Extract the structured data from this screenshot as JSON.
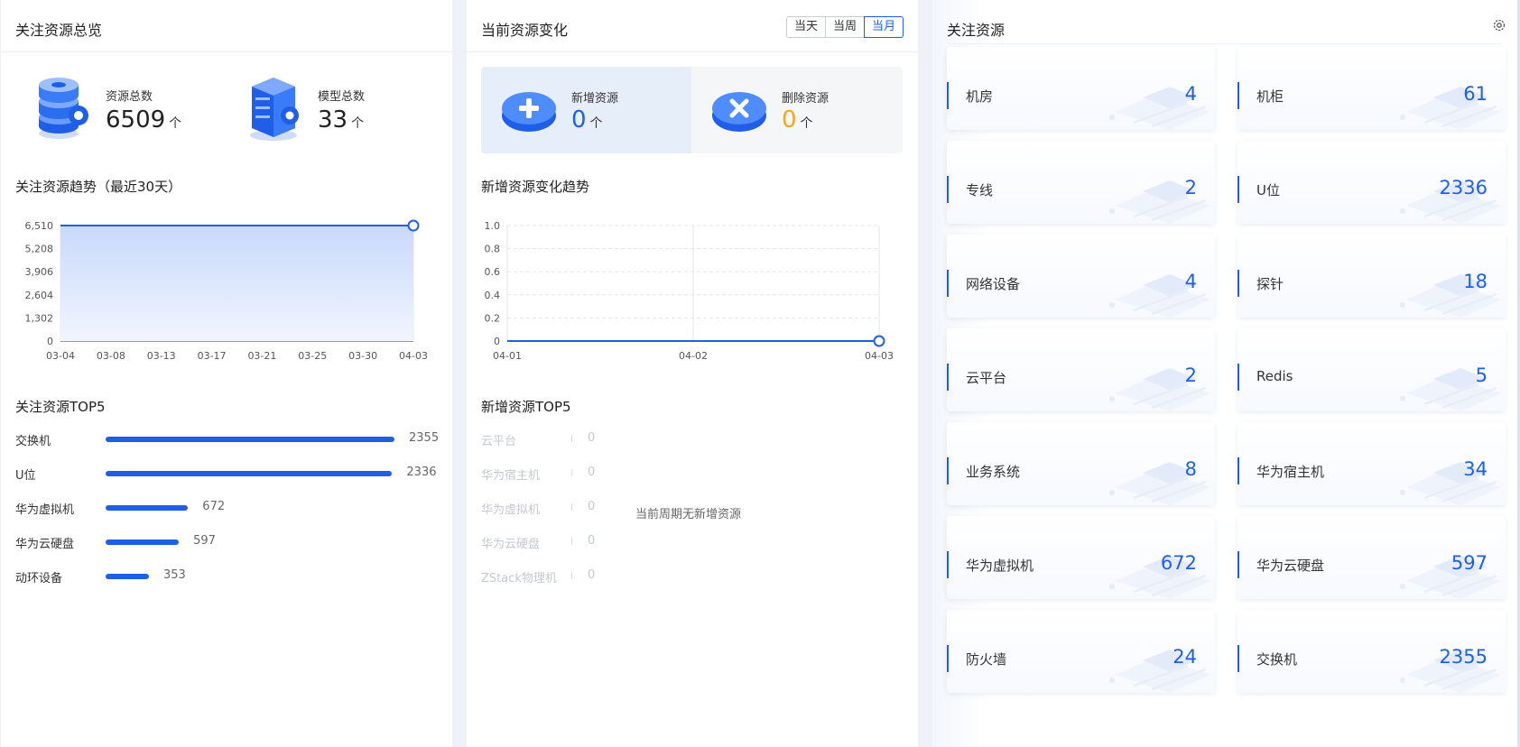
{
  "overview": {
    "title": "关注资源总览",
    "stats": [
      {
        "label": "资源总数",
        "value": "6509",
        "unit": "个"
      },
      {
        "label": "模型总数",
        "value": "33",
        "unit": "个"
      }
    ],
    "trend_title": "关注资源趋势（最近30天）",
    "top_title": "关注资源TOP5",
    "top_items": [
      {
        "name": "交换机",
        "value": 2355
      },
      {
        "name": "U位",
        "value": 2336
      },
      {
        "name": "华为虚拟机",
        "value": 672
      },
      {
        "name": "华为云硬盘",
        "value": 597
      },
      {
        "name": "动环设备",
        "value": 353
      }
    ]
  },
  "change": {
    "title": "当前资源变化",
    "periods": [
      "当天",
      "当周",
      "当月"
    ],
    "active_period": "当月",
    "added": {
      "label": "新增资源",
      "value": "0",
      "unit": "个"
    },
    "deleted": {
      "label": "删除资源",
      "value": "0",
      "unit": "个"
    },
    "trend_title": "新增资源变化趋势",
    "top_title": "新增资源TOP5",
    "empty_text": "当前周期无新增资源",
    "empty_items": [
      {
        "name": "云平台",
        "value": "0"
      },
      {
        "name": "华为宿主机",
        "value": "0"
      },
      {
        "name": "华为虚拟机",
        "value": "0"
      },
      {
        "name": "华为云硬盘",
        "value": "0"
      },
      {
        "name": "ZStack物理机",
        "value": "0"
      }
    ]
  },
  "focus": {
    "title": "关注资源",
    "settings_icon": "gear-icon",
    "cards": [
      {
        "label": "机房",
        "value": "4"
      },
      {
        "label": "机柜",
        "value": "61"
      },
      {
        "label": "专线",
        "value": "2"
      },
      {
        "label": "U位",
        "value": "2336"
      },
      {
        "label": "网络设备",
        "value": "4"
      },
      {
        "label": "探针",
        "value": "18"
      },
      {
        "label": "云平台",
        "value": "2"
      },
      {
        "label": "Redis",
        "value": "5"
      },
      {
        "label": "业务系统",
        "value": "8"
      },
      {
        "label": "华为宿主机",
        "value": "34"
      },
      {
        "label": "华为虚拟机",
        "value": "672"
      },
      {
        "label": "华为云硬盘",
        "value": "597"
      },
      {
        "label": "防火墙",
        "value": "24"
      },
      {
        "label": "交换机",
        "value": "2355"
      }
    ]
  },
  "colors": {
    "accent": "#1f5fe8",
    "orange": "#f5a623"
  },
  "chart_data": [
    {
      "type": "area",
      "x": [
        "03-04",
        "03-08",
        "03-13",
        "03-17",
        "03-21",
        "03-25",
        "03-30",
        "04-03"
      ],
      "values": [
        6509,
        6509,
        6509,
        6509,
        6509,
        6509,
        6509,
        6509
      ],
      "yticks": [
        "0",
        "1,302",
        "2,604",
        "3,906",
        "5,208",
        "6,510"
      ],
      "ylim": [
        0,
        6510
      ]
    },
    {
      "type": "line",
      "x": [
        "04-01",
        "04-02",
        "04-03"
      ],
      "values": [
        0,
        0,
        0
      ],
      "yticks": [
        "0",
        "0.2",
        "0.4",
        "0.6",
        "0.8",
        "1.0"
      ],
      "ylim": [
        0,
        1.0
      ]
    }
  ]
}
